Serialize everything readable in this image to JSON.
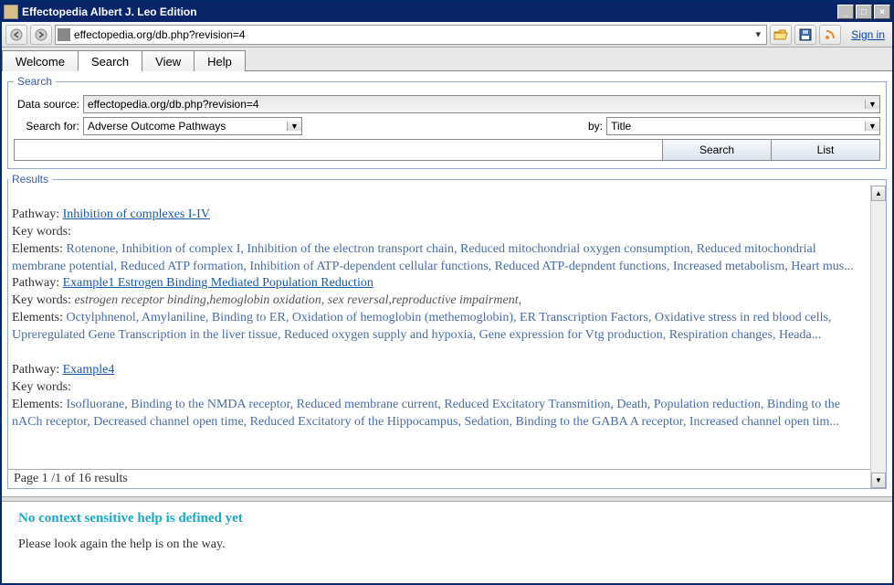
{
  "window": {
    "title": "Effectopedia  Albert J. Leo Edition"
  },
  "toolbar": {
    "address": "effectopedia.org/db.php?revision=4",
    "signin": "Sign in"
  },
  "tabs": [
    {
      "label": "Welcome"
    },
    {
      "label": "Search"
    },
    {
      "label": "View"
    },
    {
      "label": "Help"
    }
  ],
  "search": {
    "legend": "Search",
    "datasource_label": "Data source:",
    "datasource_value": "effectopedia.org/db.php?revision=4",
    "searchfor_label": "Search for:",
    "searchfor_value": "Adverse Outcome Pathways",
    "by_label": "by:",
    "by_value": "Title",
    "search_btn": "Search",
    "list_btn": "List"
  },
  "results": {
    "legend": "Results",
    "items": [
      {
        "pathway_label": "Pathway: ",
        "pathway_link": "Inhibition of complexes I-IV",
        "keywords_label": "Key words:",
        "keywords_text": "",
        "elements_label": "Elements: ",
        "elements_text": "Rotenone, Inhibition of complex I, Inhibition of the electron transport chain, Reduced mitochondrial oxygen consumption, Reduced mitochondrial membrane potential, Reduced ATP formation, Inhibition of ATP-dependent cellular functions, Reduced ATP-depndent functions, Increased metabolism, Heart mus..."
      },
      {
        "pathway_label": "Pathway: ",
        "pathway_link": "Example1 Estrogen Binding Mediated Population Reduction",
        "keywords_label": "Key words: ",
        "keywords_text": "estrogen receptor binding,hemoglobin oxidation, sex reversal,reproductive impairment,",
        "elements_label": "Elements: ",
        "elements_text": "Octylphnenol, Amylaniline, Binding to ER, Oxidation of hemoglobin (methemoglobin), ER Transcription Factors, Oxidative stress in red blood cells, Upreregulated Gene Transcription in the liver tissue, Reduced oxygen supply and hypoxia, Gene expression for Vtg production, Respiration changes, Heada..."
      },
      {
        "pathway_label": "Pathway: ",
        "pathway_link": "Example4",
        "keywords_label": "Key words:",
        "keywords_text": "",
        "elements_label": "Elements: ",
        "elements_text": "Isofluorane, Binding to the NMDA receptor, Reduced membrane current, Reduced Excitatory Transmition, Death, Population reduction, Binding to the nACh receptor, Decreased channel open time, Reduced Excitatory of the Hippocampus, Sedation, Binding to the GABA A receptor, Increased channel open tim..."
      }
    ],
    "page_text": "Page 1 /1 of 16 results",
    "page_num": "1"
  },
  "help": {
    "title": "No context sensitive help is defined yet",
    "body": "Please look again the help is on the way."
  }
}
